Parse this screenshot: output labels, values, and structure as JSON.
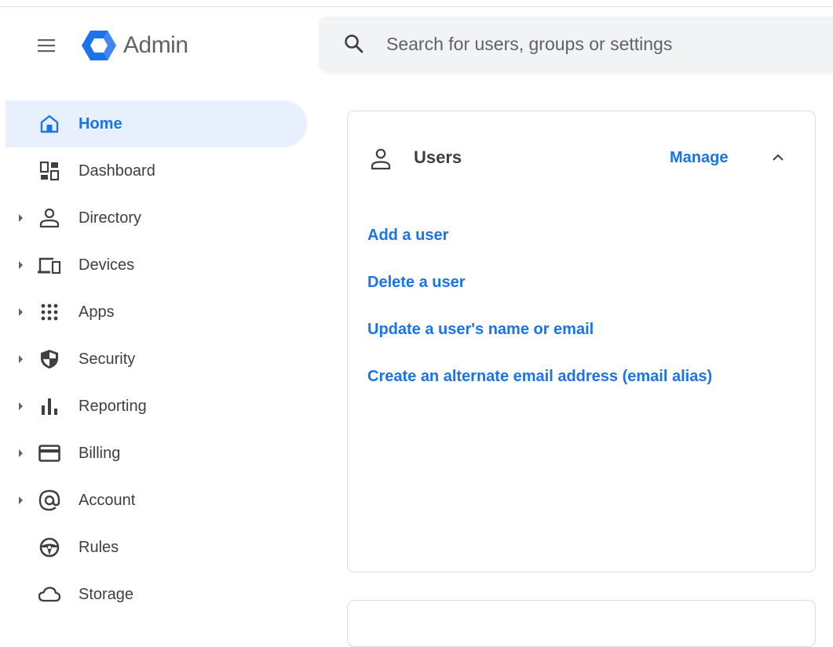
{
  "header": {
    "app_title": "Admin",
    "menu_icon": "hamburger-menu-icon",
    "logo_icon": "admin-hexagon-logo",
    "search": {
      "placeholder": "Search for users, groups or settings",
      "value": ""
    }
  },
  "sidebar": {
    "items": [
      {
        "label": "Home",
        "icon": "home-icon",
        "active": true,
        "expandable": false
      },
      {
        "label": "Dashboard",
        "icon": "dashboard-icon",
        "active": false,
        "expandable": false
      },
      {
        "label": "Directory",
        "icon": "person-icon",
        "active": false,
        "expandable": true
      },
      {
        "label": "Devices",
        "icon": "devices-icon",
        "active": false,
        "expandable": true
      },
      {
        "label": "Apps",
        "icon": "apps-grid-icon",
        "active": false,
        "expandable": true
      },
      {
        "label": "Security",
        "icon": "shield-icon",
        "active": false,
        "expandable": true
      },
      {
        "label": "Reporting",
        "icon": "bar-chart-icon",
        "active": false,
        "expandable": true
      },
      {
        "label": "Billing",
        "icon": "credit-card-icon",
        "active": false,
        "expandable": true
      },
      {
        "label": "Account",
        "icon": "at-sign-icon",
        "active": false,
        "expandable": true
      },
      {
        "label": "Rules",
        "icon": "steering-wheel-icon",
        "active": false,
        "expandable": false
      },
      {
        "label": "Storage",
        "icon": "cloud-icon",
        "active": false,
        "expandable": false
      }
    ]
  },
  "users_card": {
    "title": "Users",
    "manage_label": "Manage",
    "links": [
      "Add a user",
      "Delete a user",
      "Update a user's name or email",
      "Create an alternate email address (email alias)"
    ]
  },
  "colors": {
    "accent": "#1a73e8",
    "active_bg": "#e8f0fe",
    "icon": "#5f6368",
    "search_bg": "#f1f3f4"
  }
}
